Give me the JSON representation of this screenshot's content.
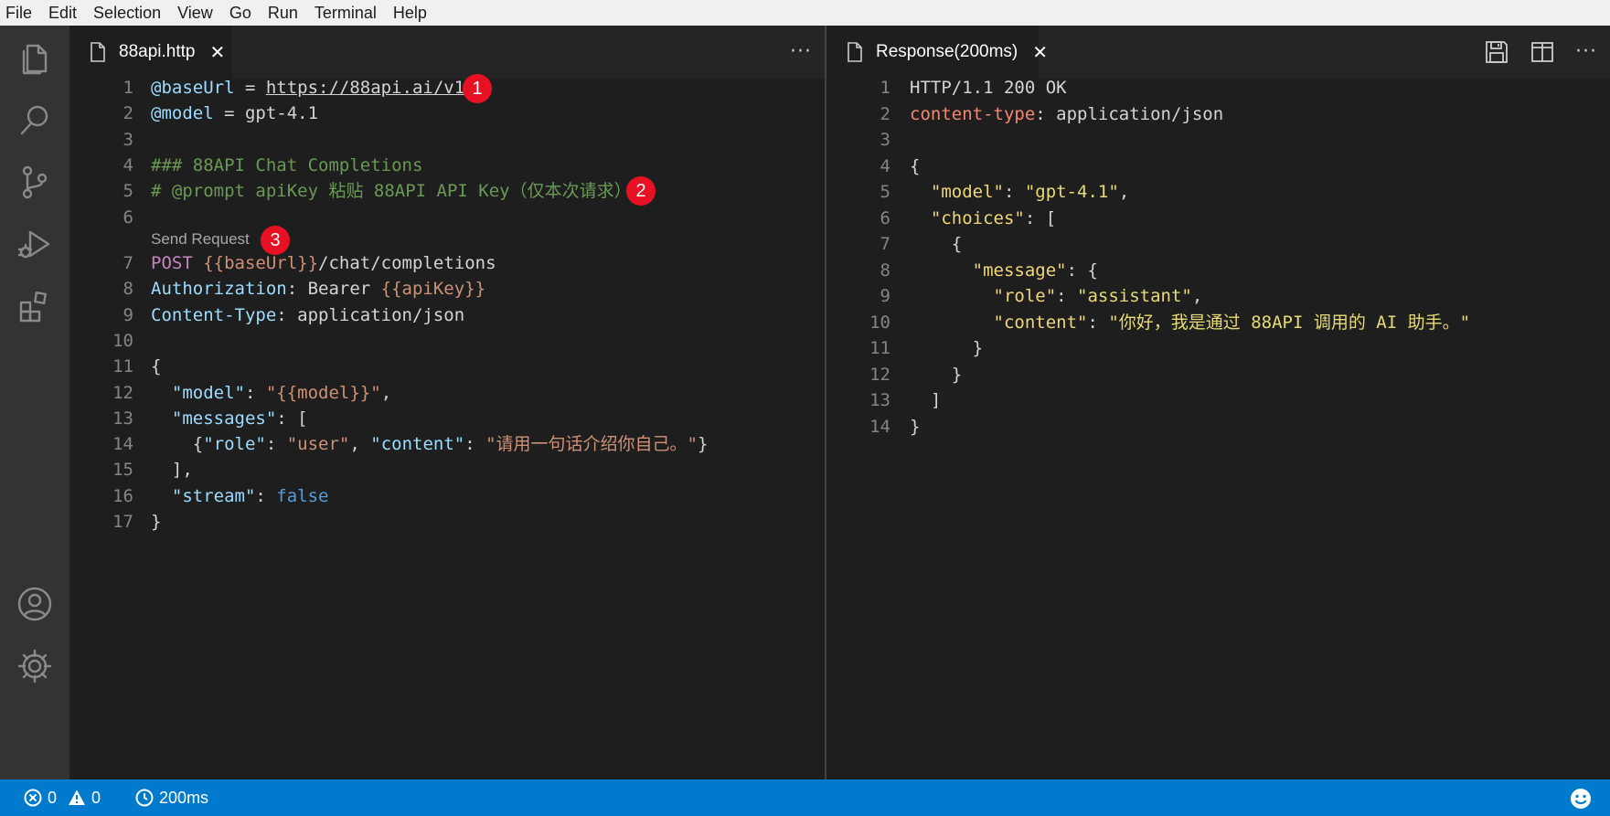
{
  "menu": [
    "File",
    "Edit",
    "Selection",
    "View",
    "Go",
    "Run",
    "Terminal",
    "Help"
  ],
  "left_tab": {
    "label": "88api.http",
    "close": "✕"
  },
  "right_tab": {
    "label": "Response(200ms)",
    "close": "✕"
  },
  "more_label": "···",
  "codelens": "Send Request",
  "badges": [
    "1",
    "2",
    "3"
  ],
  "left_lines": [
    {
      "n": "1",
      "parts": [
        [
          "@baseUrl",
          "var"
        ],
        [
          " = ",
          "plain"
        ],
        [
          "https://88api.ai/v1",
          "url"
        ]
      ]
    },
    {
      "n": "2",
      "parts": [
        [
          "@model",
          "var"
        ],
        [
          " = gpt-4.1",
          "plain"
        ]
      ]
    },
    {
      "n": "3",
      "parts": []
    },
    {
      "n": "4",
      "parts": [
        [
          "### 88API Chat Completions",
          "comment"
        ]
      ]
    },
    {
      "n": "5",
      "parts": [
        [
          "# @prompt apiKey 粘贴 88API API Key（仅本次请求）",
          "comment"
        ]
      ]
    },
    {
      "n": "6",
      "parts": []
    },
    {
      "n": "7",
      "parts": [
        [
          "POST ",
          "keyword"
        ],
        [
          "{{baseUrl}}",
          "tmpl"
        ],
        [
          "/chat/completions",
          "plain"
        ]
      ]
    },
    {
      "n": "8",
      "parts": [
        [
          "Authorization",
          "header"
        ],
        [
          ": Bearer ",
          "plain"
        ],
        [
          "{{apiKey}}",
          "tmpl"
        ]
      ]
    },
    {
      "n": "9",
      "parts": [
        [
          "Content-Type",
          "header"
        ],
        [
          ": application/json",
          "plain"
        ]
      ]
    },
    {
      "n": "10",
      "parts": []
    },
    {
      "n": "11",
      "parts": [
        [
          "{",
          "plain"
        ]
      ]
    },
    {
      "n": "12",
      "parts": [
        [
          "  ",
          "plain"
        ],
        [
          "\"model\"",
          "var"
        ],
        [
          ": ",
          "plain"
        ],
        [
          "\"{{model}}\"",
          "string"
        ],
        [
          ",",
          "plain"
        ]
      ]
    },
    {
      "n": "13",
      "parts": [
        [
          "  ",
          "plain"
        ],
        [
          "\"messages\"",
          "var"
        ],
        [
          ": [",
          "plain"
        ]
      ]
    },
    {
      "n": "14",
      "parts": [
        [
          "    {",
          "plain"
        ],
        [
          "\"role\"",
          "var"
        ],
        [
          ": ",
          "plain"
        ],
        [
          "\"user\"",
          "string"
        ],
        [
          ", ",
          "plain"
        ],
        [
          "\"content\"",
          "var"
        ],
        [
          ": ",
          "plain"
        ],
        [
          "\"请用一句话介绍你自己。\"",
          "string"
        ],
        [
          "}",
          "plain"
        ]
      ]
    },
    {
      "n": "15",
      "parts": [
        [
          "  ],",
          "plain"
        ]
      ]
    },
    {
      "n": "16",
      "parts": [
        [
          "  ",
          "plain"
        ],
        [
          "\"stream\"",
          "var"
        ],
        [
          ": ",
          "plain"
        ],
        [
          "false",
          "bool"
        ]
      ]
    },
    {
      "n": "17",
      "parts": [
        [
          "}",
          "plain"
        ]
      ]
    }
  ],
  "right_lines": [
    {
      "n": "1",
      "parts": [
        [
          "HTTP/1.1 200 OK",
          "plain"
        ]
      ]
    },
    {
      "n": "2",
      "parts": [
        [
          "content-type",
          "resp-hdr"
        ],
        [
          ": application/json",
          "plain"
        ]
      ]
    },
    {
      "n": "3",
      "parts": []
    },
    {
      "n": "4",
      "parts": [
        [
          "{",
          "plain"
        ]
      ]
    },
    {
      "n": "5",
      "parts": [
        [
          "  ",
          "plain"
        ],
        [
          "\"model\"",
          "key-y"
        ],
        [
          ": ",
          "plain"
        ],
        [
          "\"gpt-4.1\"",
          "str-y"
        ],
        [
          ",",
          "plain"
        ]
      ]
    },
    {
      "n": "6",
      "parts": [
        [
          "  ",
          "plain"
        ],
        [
          "\"choices\"",
          "key-y"
        ],
        [
          ": [",
          "plain"
        ]
      ]
    },
    {
      "n": "7",
      "parts": [
        [
          "    {",
          "plain"
        ]
      ]
    },
    {
      "n": "8",
      "parts": [
        [
          "      ",
          "plain"
        ],
        [
          "\"message\"",
          "key-y"
        ],
        [
          ": {",
          "plain"
        ]
      ]
    },
    {
      "n": "9",
      "parts": [
        [
          "        ",
          "plain"
        ],
        [
          "\"role\"",
          "key-y"
        ],
        [
          ": ",
          "plain"
        ],
        [
          "\"assistant\"",
          "str-y"
        ],
        [
          ",",
          "plain"
        ]
      ]
    },
    {
      "n": "10",
      "parts": [
        [
          "        ",
          "plain"
        ],
        [
          "\"content\"",
          "key-y"
        ],
        [
          ": ",
          "plain"
        ],
        [
          "\"你好，我是通过 88API 调用的 AI 助手。\"",
          "str-y"
        ]
      ]
    },
    {
      "n": "11",
      "parts": [
        [
          "      }",
          "plain"
        ]
      ]
    },
    {
      "n": "12",
      "parts": [
        [
          "    }",
          "plain"
        ]
      ]
    },
    {
      "n": "13",
      "parts": [
        [
          "  ]",
          "plain"
        ]
      ]
    },
    {
      "n": "14",
      "parts": [
        [
          "}",
          "plain"
        ]
      ]
    }
  ],
  "status": {
    "errors": "0",
    "warnings": "0",
    "time": "200ms"
  },
  "colors": {
    "accent": "#007acc",
    "badge": "#e81123"
  }
}
